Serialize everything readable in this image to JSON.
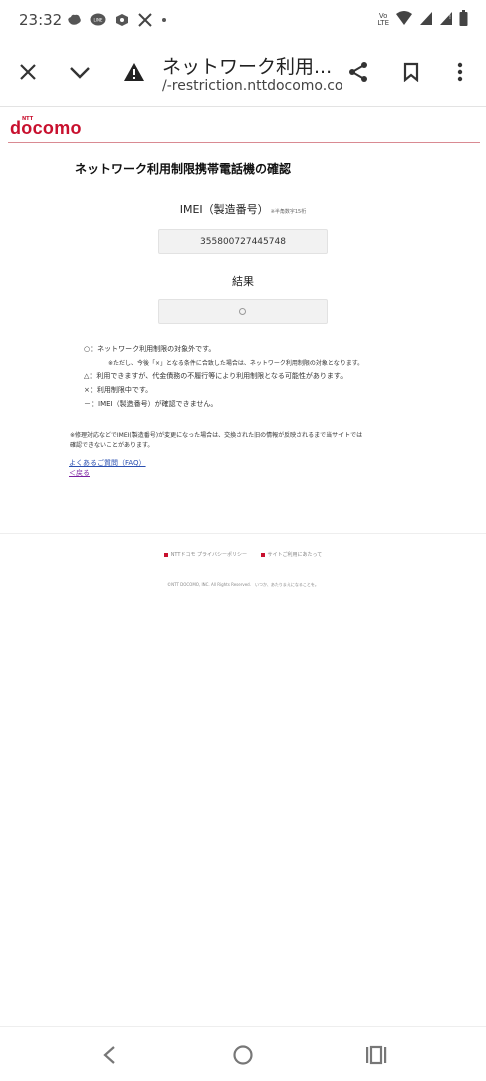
{
  "status_bar": {
    "time": "23:32",
    "notification_icons": [
      "chrome-icon",
      "line-icon",
      "box-icon",
      "x-icon",
      "dot-icon"
    ],
    "volte_label_top": "Vo",
    "volte_label_bottom": "LTE",
    "right_icons": [
      "wifi-icon",
      "signal-icon",
      "signal-icon",
      "battery-icon"
    ]
  },
  "browser": {
    "title": "ネットワーク利用...",
    "url": "/-restriction.nttdocomo.co.jp",
    "icons": [
      "close-icon",
      "chevron-down-icon",
      "warning-icon",
      "share-icon",
      "bookmark-icon",
      "more-icon"
    ]
  },
  "page": {
    "logo_text": "docomo",
    "logo_ntt": "NTT",
    "brand_color": "#c8102e",
    "title": "ネットワーク利用制限携帯電話機の確認",
    "imei_label": "IMEI（製造番号）",
    "imei_sub": "※半角数字15桁",
    "imei_value": "355800727445748",
    "result_label": "結果",
    "legend": [
      {
        "symbol": "○",
        "text": "：ネットワーク利用制限の対象外です。"
      },
      {
        "symbol": "",
        "text": "※ただし、今後「×」となる条件に合致した場合は、ネットワーク利用制限の対象となります。"
      },
      {
        "symbol": "△",
        "text": "：利用できますが、代金債務の不履行等により利用制限となる可能性があります。"
      },
      {
        "symbol": "×",
        "text": "：利用制限中です。"
      },
      {
        "symbol": "－",
        "text": "：IMEI（製造番号）が確認できません。"
      }
    ],
    "notice_line1": "※修理対応などでIMEI(製造番号)が変更になった場合は、交換された旧の情報が反映されるまで当サイトでは",
    "notice_line2": "確認できないことがあります。",
    "faq_link": "よくあるご質問（FAQ）",
    "back_link": "＜戻る",
    "footer_link1": "NTTドコモ プライバシーポリシー",
    "footer_link2": "サイトご利用にあたって",
    "copyright": "©NTT DOCOMO, INC. All Rights Reserved.　いつか、あたりまえになることを。"
  },
  "nav_bar": {
    "icons": [
      "back-icon",
      "home-icon",
      "recents-icon"
    ]
  }
}
